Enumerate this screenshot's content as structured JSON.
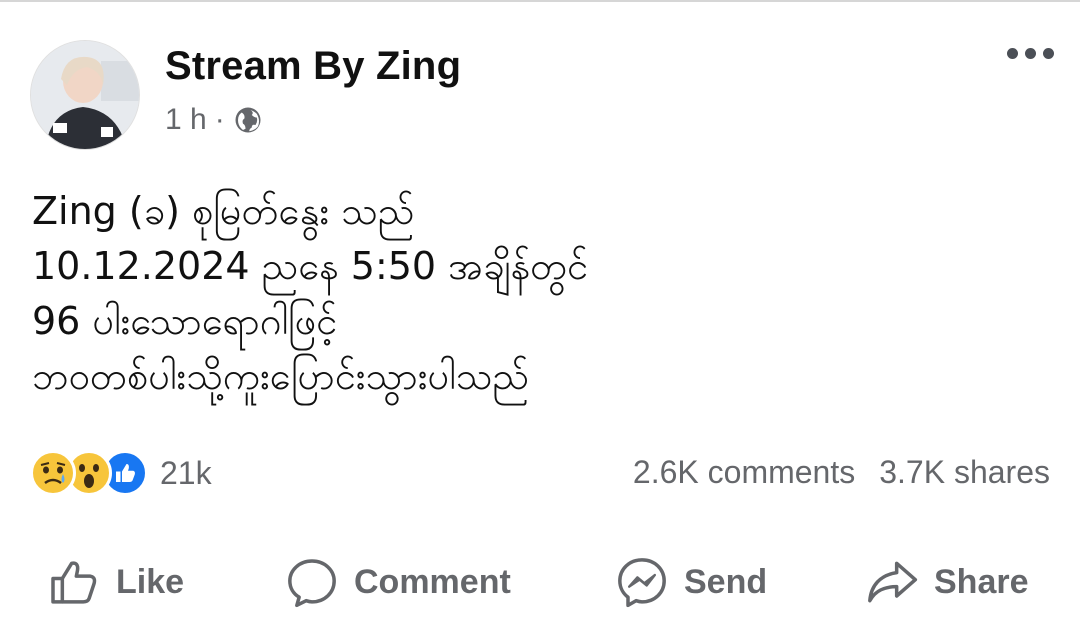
{
  "post": {
    "author": "Stream By Zing",
    "time": "1 h",
    "separator": "·",
    "privacy_icon": "globe-icon",
    "lines": [
      "Zing (ခ) စုမြတ်နွေး သည်",
      "10.12.2024 ညနေ 5:50 အချိန်တွင်",
      "96 ပါးသောရောဂါဖြင့်",
      "ဘဝတစ်ပါးသို့ကူးပြောင်းသွားပါသည်"
    ]
  },
  "reactions": {
    "icons": [
      "sad-icon",
      "wow-icon",
      "like-icon"
    ],
    "count": "21k"
  },
  "stats": {
    "comments": "2.6K comments",
    "shares": "3.7K shares"
  },
  "actions": {
    "like": "Like",
    "comment": "Comment",
    "send": "Send",
    "share": "Share"
  },
  "colors": {
    "muted": "#65676b",
    "like_blue": "#1877f2",
    "emoji_yellow": "#f7c53b"
  }
}
